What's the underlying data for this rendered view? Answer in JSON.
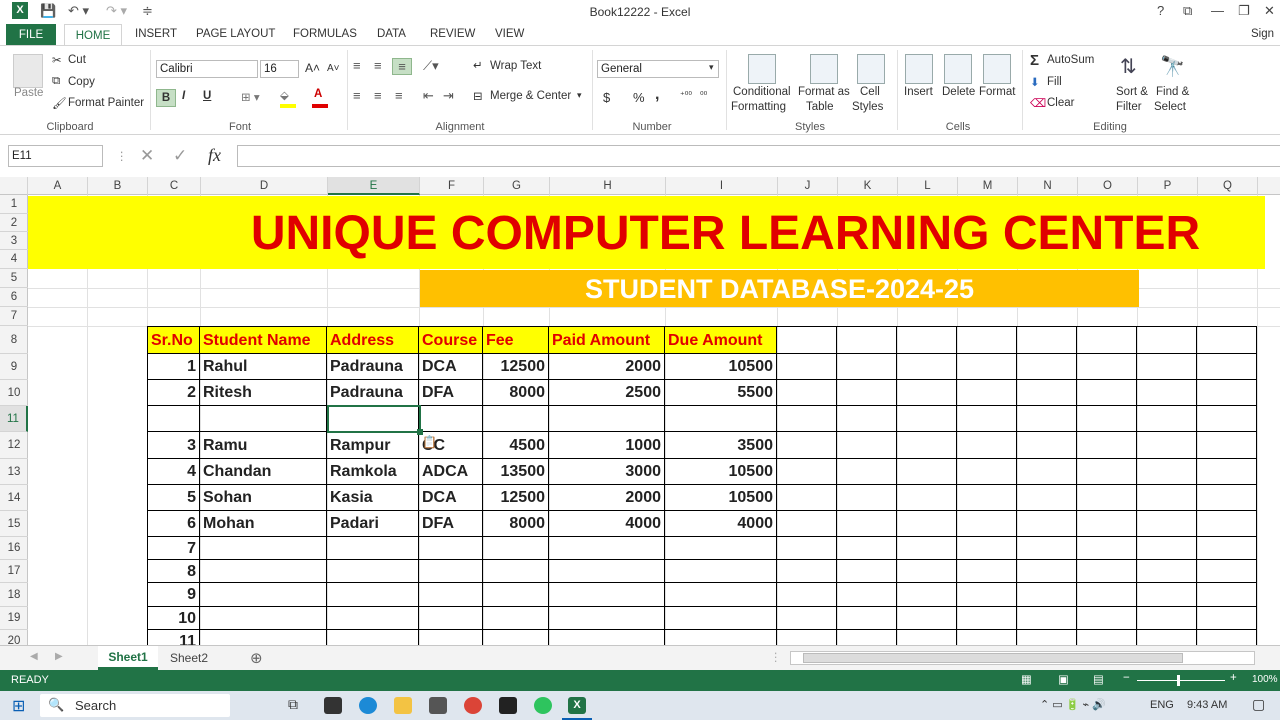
{
  "window": {
    "title": "Book12222 - Excel",
    "sign_in": "Sign"
  },
  "tabs": [
    "FILE",
    "HOME",
    "INSERT",
    "PAGE LAYOUT",
    "FORMULAS",
    "DATA",
    "REVIEW",
    "VIEW"
  ],
  "ribbon": {
    "clipboard": {
      "paste": "Paste",
      "cut": "Cut",
      "copy": "Copy",
      "format_painter": "Format Painter",
      "group": "Clipboard"
    },
    "font": {
      "name": "Calibri",
      "size": "16",
      "bold": "B",
      "italic": "I",
      "underline": "U",
      "group": "Font"
    },
    "alignment": {
      "wrap": "Wrap Text",
      "merge": "Merge & Center",
      "group": "Alignment"
    },
    "number": {
      "format": "General",
      "currency": "$",
      "percent": "%",
      "comma": ",",
      "group": "Number"
    },
    "styles": {
      "cond": "Conditional",
      "cond2": "Formatting",
      "fmt_table": "Format as",
      "fmt_table2": "Table",
      "cell_styles": "Cell",
      "cell_styles2": "Styles",
      "group": "Styles"
    },
    "cells": {
      "insert": "Insert",
      "delete": "Delete",
      "format": "Format",
      "group": "Cells"
    },
    "editing": {
      "autosum": "AutoSum",
      "fill": "Fill",
      "clear": "Clear",
      "sort": "Sort &",
      "sort2": "Filter",
      "find": "Find &",
      "find2": "Select",
      "group": "Editing"
    }
  },
  "formula_bar": {
    "name_box": "E11",
    "fx": "fx",
    "value": ""
  },
  "columns": [
    "A",
    "B",
    "C",
    "D",
    "E",
    "F",
    "G",
    "H",
    "I",
    "J",
    "K",
    "L",
    "M",
    "N",
    "O",
    "P",
    "Q"
  ],
  "rows": [
    "1",
    "2",
    "3",
    "4",
    "5",
    "6",
    "7",
    "8",
    "9",
    "10",
    "11",
    "12",
    "13",
    "14",
    "15",
    "16",
    "17",
    "18",
    "19",
    "20"
  ],
  "sheet": {
    "banner": "UNIQUE COMPUTER LEARNING CENTER",
    "subtitle": "STUDENT DATABASE-2024-25",
    "headers": [
      "Sr.No",
      "Student Name",
      "Address",
      "Course",
      "Fee",
      "Paid Amount",
      "Due Amount"
    ],
    "data": [
      [
        "1",
        "Rahul",
        "Padrauna",
        "DCA",
        "12500",
        "2000",
        "10500"
      ],
      [
        "2",
        "Ritesh",
        "Padrauna",
        "DFA",
        "8000",
        "2500",
        "5500"
      ],
      [
        "",
        "",
        "",
        "",
        "",
        "",
        ""
      ],
      [
        "3",
        "Ramu",
        "Rampur",
        "CC",
        "4500",
        "1000",
        "3500"
      ],
      [
        "4",
        "Chandan",
        "Ramkola",
        "ADCA",
        "13500",
        "3000",
        "10500"
      ],
      [
        "5",
        "Sohan",
        "Kasia",
        "DCA",
        "12500",
        "2000",
        "10500"
      ],
      [
        "6",
        "Mohan",
        "Padari",
        "DFA",
        "8000",
        "4000",
        "4000"
      ],
      [
        "7",
        "",
        "",
        "",
        "",
        "",
        ""
      ],
      [
        "8",
        "",
        "",
        "",
        "",
        "",
        ""
      ],
      [
        "9",
        "",
        "",
        "",
        "",
        "",
        ""
      ],
      [
        "10",
        "",
        "",
        "",
        "",
        "",
        ""
      ],
      [
        "11",
        "",
        "",
        "",
        "",
        "",
        ""
      ]
    ]
  },
  "sheet_tabs": [
    "Sheet1",
    "Sheet2"
  ],
  "status": {
    "text": "READY",
    "zoom": "100%"
  },
  "taskbar": {
    "search": "Search",
    "lang": "ENG",
    "time": "9:43 AM"
  },
  "colors": {
    "excel_green": "#217346",
    "banner_bg": "#ffff00",
    "banner_text": "#e00000",
    "subtitle_bg": "#ffc000"
  }
}
